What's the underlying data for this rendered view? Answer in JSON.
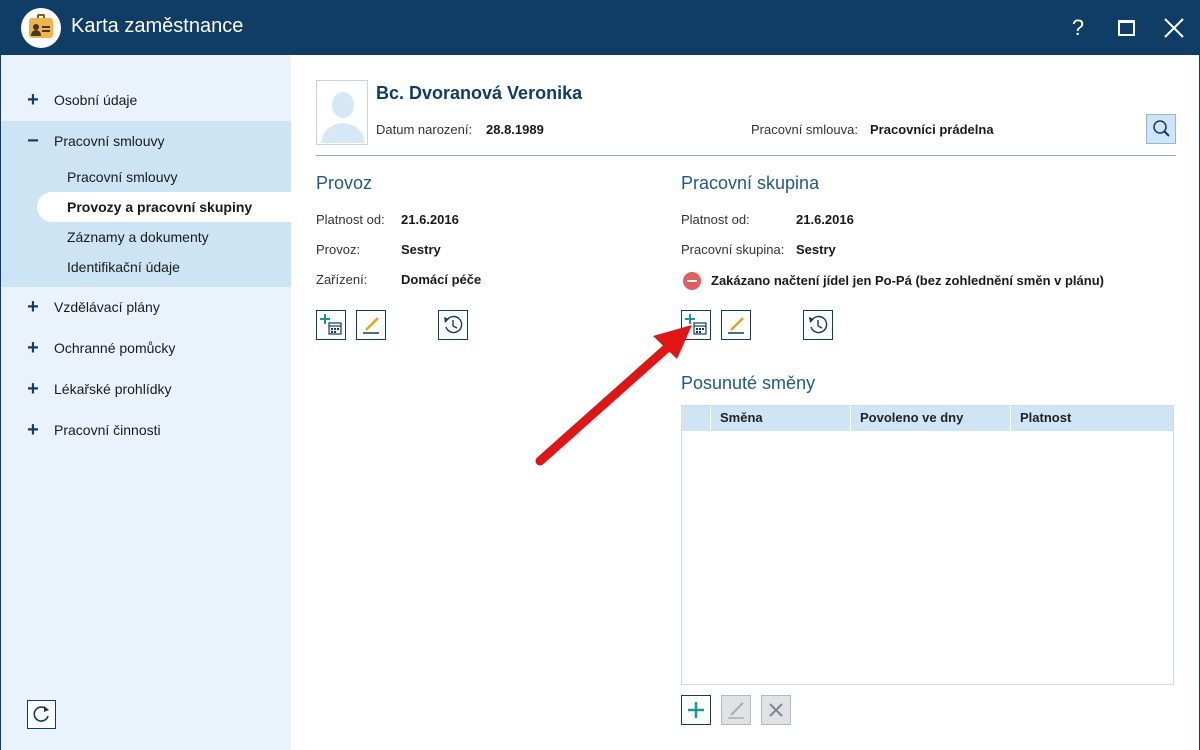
{
  "window": {
    "title": "Karta zaměstnance",
    "help_label": "?",
    "close_label": "✕"
  },
  "sidebar": {
    "items": [
      {
        "sign": "+",
        "label": "Osobní údaje"
      },
      {
        "sign": "−",
        "label": "Pracovní smlouvy"
      },
      {
        "sign": "+",
        "label": "Vzdělávací plány"
      },
      {
        "sign": "+",
        "label": "Ochranné pomůcky"
      },
      {
        "sign": "+",
        "label": "Lékařské prohlídky"
      },
      {
        "sign": "+",
        "label": "Pracovní činnosti"
      }
    ],
    "subitems": [
      {
        "label": "Pracovní smlouvy"
      },
      {
        "label": "Provozy a pracovní skupiny"
      },
      {
        "label": "Záznamy a dokumenty"
      },
      {
        "label": "Identifikační údaje"
      }
    ],
    "active_subitem": "Provozy a pracovní skupiny"
  },
  "employee": {
    "name": "Bc. Dvoranová Veronika",
    "birth_label": "Datum narození:",
    "birth_value": "28.8.1989",
    "contract_label": "Pracovní smlouva:",
    "contract_value": "Pracovníci prádelna"
  },
  "provoz": {
    "title": "Provoz",
    "fields": [
      {
        "label": "Platnost od:",
        "value": "21.6.2016"
      },
      {
        "label": "Provoz:",
        "value": "Sestry"
      },
      {
        "label": "Zařízení:",
        "value": "Domácí péče"
      }
    ]
  },
  "skupina": {
    "title": "Pracovní skupina",
    "fields": [
      {
        "label": "Platnost od:",
        "value": "21.6.2016"
      },
      {
        "label": "Pracovní skupina:",
        "value": "Sestry"
      }
    ],
    "warning": "Zakázano načtení jídel jen Po-Pá (bez zohlednění směn v plánu)"
  },
  "shifts": {
    "title": "Posunuté směny",
    "columns": [
      "Směna",
      "Povoleno ve dny",
      "Platnost"
    ],
    "rows": []
  },
  "colors": {
    "titlebar": "#0f3d66",
    "accent": "#1f5a8a",
    "sidebar_bg": "#eaf3fb",
    "sidebar_group_bg": "#cce4f4",
    "warning": "#e06060",
    "arrow": "#e01515",
    "add_icon": "#1a9a8a",
    "edit_icon": "#e8a020"
  },
  "icons": {
    "app": "employee-card-icon",
    "search": "search-icon",
    "refresh": "refresh-icon",
    "add_period": "calendar-add-icon",
    "edit": "pencil-icon",
    "history": "history-clock-icon",
    "add": "plus-icon",
    "delete": "close-icon"
  }
}
